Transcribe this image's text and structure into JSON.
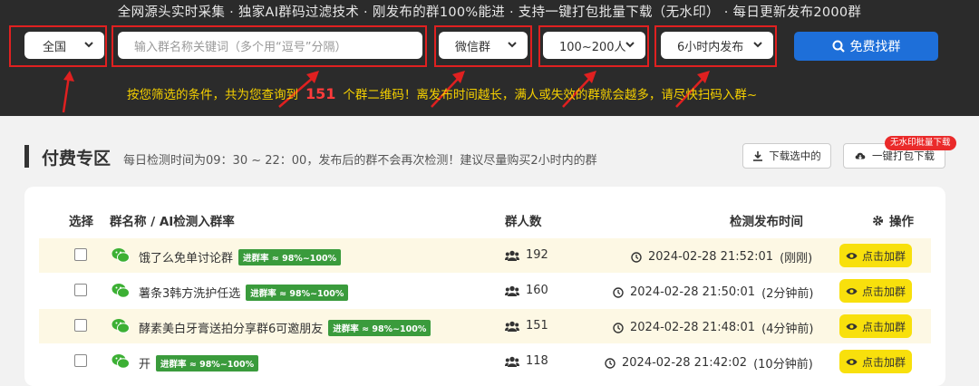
{
  "header": {
    "tagline": "全网源头实时采集 · 独家AI群码过滤技术 · 刚发布的群100%能进 · 支持一键打包批量下载（无水印） · 每日更新发布2000群"
  },
  "filters": {
    "region": "全国",
    "keyword_placeholder": "输入群名称关键词（多个用“逗号”分隔）",
    "group_type": "微信群",
    "member_range": "100~200人",
    "publish_time": "6小时内发布",
    "find_button": "免费找群"
  },
  "result": {
    "prefix": "按您筛选的条件，共为您查询到",
    "count": "151",
    "suffix": "个群二维码！离发布时间越长，满人或失效的群就会越多，请尽快扫码入群~"
  },
  "section": {
    "title": "付费专区",
    "subtitle": "每日检测时间为09：30 ~ 22：00，发布后的群不会再次检测！建议尽量购买2小时内的群",
    "download_selected": "下载选中的",
    "download_all": "一键打包下载",
    "badge": "无水印批量下载"
  },
  "table": {
    "headers": {
      "select": "选择",
      "name": "群名称 / AI检测入群率",
      "members": "群人数",
      "time": "检测发布时间",
      "action": "操作"
    },
    "join_label": "点击加群",
    "rows": [
      {
        "name": "饿了么免单讨论群",
        "rate": "进群率 ≈ 98%~100%",
        "members": "192",
        "time": "2024-02-28 21:52:01",
        "ago": "(刚刚)"
      },
      {
        "name": "薯条3韩方洗护任选",
        "rate": "进群率 ≈ 98%~100%",
        "members": "160",
        "time": "2024-02-28 21:50:01",
        "ago": "(2分钟前)"
      },
      {
        "name": "酵素美白牙膏送拍分享群6可邀朋友",
        "rate": "进群率 ≈ 98%~100%",
        "members": "151",
        "time": "2024-02-28 21:48:01",
        "ago": "(4分钟前)"
      },
      {
        "name": "开",
        "rate": "进群率 ≈ 98%~100%",
        "members": "118",
        "time": "2024-02-28 21:42:02",
        "ago": "(10分钟前)"
      }
    ]
  }
}
